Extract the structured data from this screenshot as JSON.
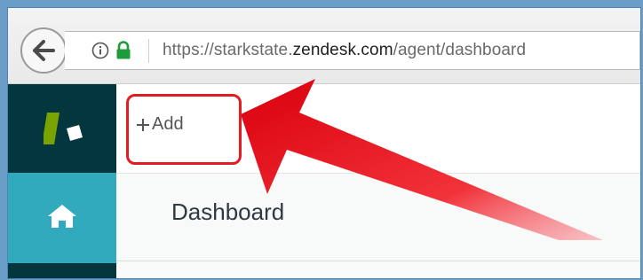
{
  "browser": {
    "url_prefix": "https://starkstate.",
    "url_host": "zendesk.com",
    "url_path": "/agent/dashboard"
  },
  "sidebar": {
    "items": [
      {
        "icon": "zendesk-logo-icon"
      },
      {
        "icon": "home-icon"
      }
    ],
    "active_color": "#30aabc",
    "background_color": "#03363d"
  },
  "topbar": {
    "add_label": "Add"
  },
  "main": {
    "title": "Dashboard"
  },
  "annotation": {
    "highlight_color": "#e41b23"
  }
}
